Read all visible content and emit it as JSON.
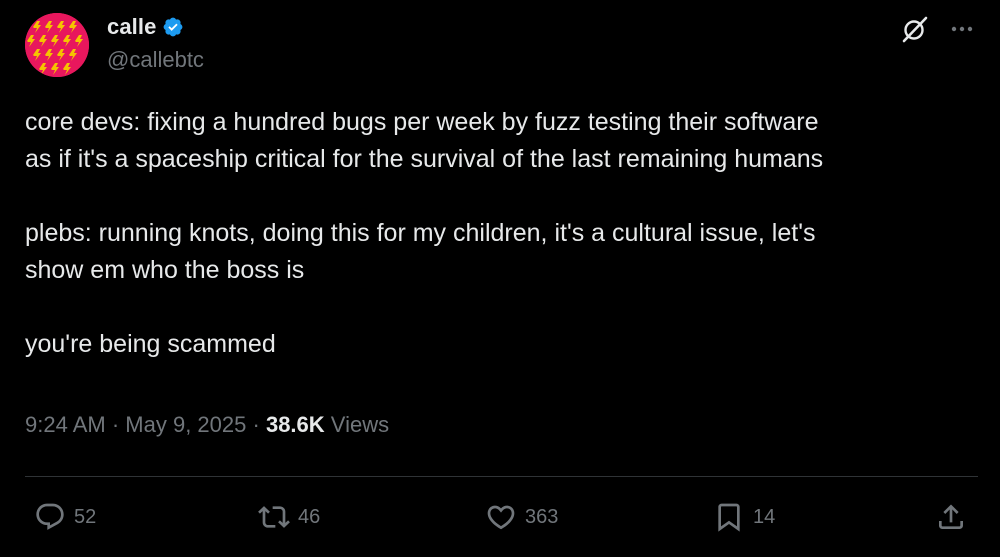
{
  "author": {
    "display_name": "calle",
    "handle": "@callebtc",
    "verified": true,
    "avatar_color": "#e8175d"
  },
  "tweet": {
    "paragraphs": [
      [
        "core devs: fixing a hundred bugs per week by fuzz testing their software",
        "as if it's a spaceship critical for the survival of the last remaining humans"
      ],
      [
        "plebs: running knots, doing this for my children, it's a cultural issue, let's",
        "show em who the boss is"
      ],
      [
        "you're being scammed"
      ]
    ]
  },
  "meta": {
    "time": "9:24 AM",
    "separator": "·",
    "date": "May 9, 2025",
    "views_count": "38.6K",
    "views_label": "Views"
  },
  "actions": {
    "replies": "52",
    "reposts": "46",
    "likes": "363",
    "bookmarks": "14"
  },
  "icons": {
    "verified": "verified-badge-icon",
    "grok": "grok-icon",
    "more": "more-icon",
    "reply": "reply-icon",
    "repost": "repost-icon",
    "like": "heart-icon",
    "bookmark": "bookmark-icon",
    "share": "share-icon"
  },
  "colors": {
    "background": "#000000",
    "text": "#e7e9ea",
    "secondary": "#71767b",
    "verified": "#1d9bf0",
    "divider": "#2f3336"
  }
}
